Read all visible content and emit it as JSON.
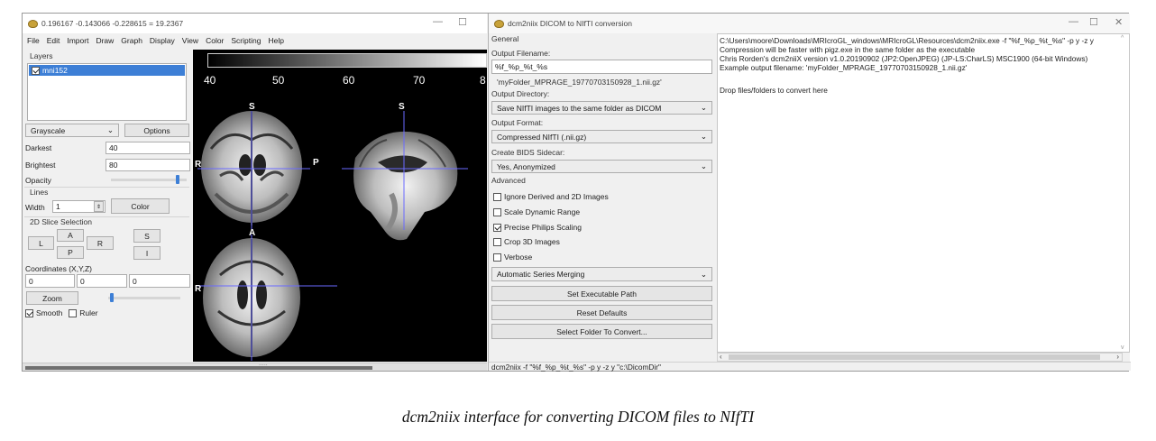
{
  "mri": {
    "title": "0.196167 -0.143066 -0.228615 = 19.2367",
    "window_controls": {
      "minimize": "—",
      "maximize": "☐"
    },
    "menu": [
      "File",
      "Edit",
      "Import",
      "Draw",
      "Graph",
      "Display",
      "View",
      "Color",
      "Scripting",
      "Help"
    ],
    "layers": {
      "label": "Layers",
      "items": [
        {
          "name": "mni152",
          "checked": true
        }
      ]
    },
    "colormap": {
      "value": "Grayscale",
      "options_label": "Options"
    },
    "darkest": {
      "label": "Darkest",
      "value": "40"
    },
    "brightest": {
      "label": "Brightest",
      "value": "80"
    },
    "opacity_label": "Opacity",
    "lines": {
      "label": "Lines",
      "width_label": "Width",
      "width_value": "1",
      "color_label": "Color"
    },
    "slice": {
      "label": "2D Slice Selection",
      "buttons": [
        "A",
        "L",
        "R",
        "P",
        "S",
        "I"
      ]
    },
    "coords": {
      "label": "Coordinates (X,Y,Z)",
      "x": "0",
      "y": "0",
      "z": "0"
    },
    "zoom_label": "Zoom",
    "smooth": {
      "label": "Smooth",
      "checked": true
    },
    "ruler": {
      "label": "Ruler",
      "checked": false
    },
    "colorbar_ticks": [
      "40",
      "50",
      "60",
      "70",
      "8"
    ],
    "orientation_labels": {
      "s1": "S",
      "s2": "S",
      "r1": "R",
      "p": "P",
      "a": "A",
      "r2": "R"
    },
    "status_grip": "....."
  },
  "dcm": {
    "title": "dcm2niix DICOM to NIfTI conversion",
    "window_controls": {
      "minimize": "—",
      "maximize": "☐",
      "close": "✕"
    },
    "general_label": "General",
    "output_filename_label": "Output Filename:",
    "output_filename_value": "%f_%p_%t_%s",
    "example_filename": "'myFolder_MPRAGE_19770703150928_1.nii.gz'",
    "output_directory_label": "Output Directory:",
    "output_directory_value": "Save NIfTI images to the same folder as DICOM",
    "output_format_label": "Output Format:",
    "output_format_value": "Compressed NIfTI (.nii.gz)",
    "bids_label": "Create BIDS Sidecar:",
    "bids_value": "Yes, Anonymized",
    "advanced_label": "Advanced",
    "options": [
      {
        "label": "Ignore Derived and 2D Images",
        "checked": false
      },
      {
        "label": "Scale Dynamic Range",
        "checked": false
      },
      {
        "label": "Precise Philips Scaling",
        "checked": true
      },
      {
        "label": "Crop 3D Images",
        "checked": false
      },
      {
        "label": "Verbose",
        "checked": false
      }
    ],
    "merge_value": "Automatic Series Merging",
    "set_path_label": "Set Executable Path",
    "reset_label": "Reset Defaults",
    "select_folder_label": "Select Folder To Convert...",
    "log": [
      "C:\\Users\\moore\\Downloads\\MRIcroGL_windows\\MRIcroGL\\Resources\\dcm2niix.exe -f \"%f_%p_%t_%s\" -p y -z y",
      "Compression will be faster with pigz.exe in the same folder as the executable",
      "Chris Rorden's dcm2niiX version v1.0.20190902  (JP2:OpenJPEG) (JP-LS:CharLS) MSC1900 (64-bit Windows)",
      "Example output filename: 'myFolder_MPRAGE_19770703150928_1.nii.gz'",
      "",
      "Drop files/folders to convert here"
    ],
    "status": "dcm2niix -f \"%f_%p_%t_%s\" -p y -z y \"c:\\DicomDir\""
  },
  "caption": "dcm2niix interface for converting DICOM files to NIfTI"
}
